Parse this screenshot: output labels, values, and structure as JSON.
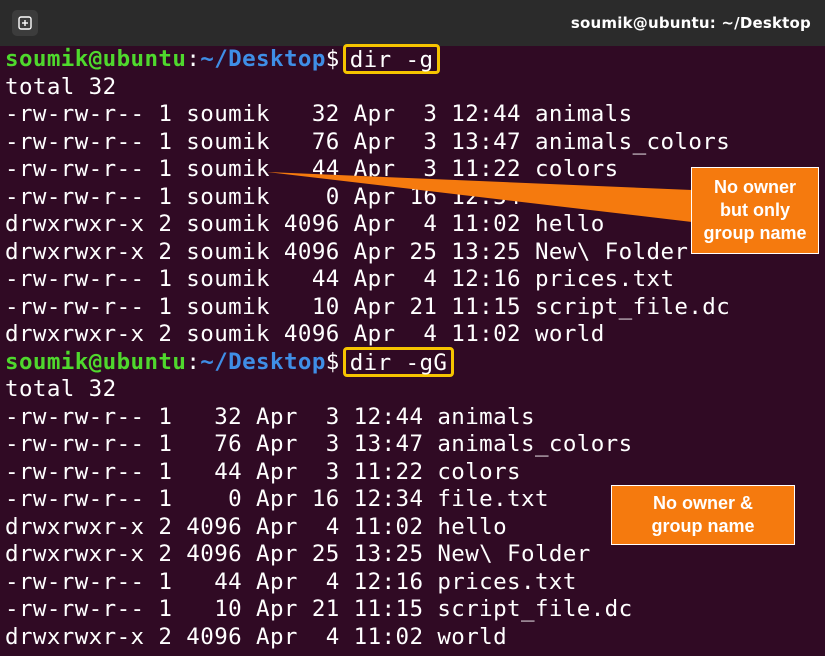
{
  "window": {
    "title": "soumik@ubuntu: ~/Desktop"
  },
  "prompt": {
    "user_host": "soumik@ubuntu",
    "colon": ":",
    "path": "~/Desktop",
    "dollar": "$"
  },
  "block1": {
    "command": "dir -g",
    "total": "total 32",
    "rows": [
      "-rw-rw-r-- 1 soumik   32 Apr  3 12:44 animals",
      "-rw-rw-r-- 1 soumik   76 Apr  3 13:47 animals_colors",
      "-rw-rw-r-- 1 soumik   44 Apr  3 11:22 colors",
      "-rw-rw-r-- 1 soumik    0 Apr 16 12:34 file.txt",
      "drwxrwxr-x 2 soumik 4096 Apr  4 11:02 hello",
      "drwxrwxr-x 2 soumik 4096 Apr 25 13:25 New\\ Folder",
      "-rw-rw-r-- 1 soumik   44 Apr  4 12:16 prices.txt",
      "-rw-rw-r-- 1 soumik   10 Apr 21 11:15 script_file.dc",
      "drwxrwxr-x 2 soumik 4096 Apr  4 11:02 world"
    ]
  },
  "block2": {
    "command": "dir -gG",
    "total": "total 32",
    "rows": [
      "-rw-rw-r-- 1   32 Apr  3 12:44 animals",
      "-rw-rw-r-- 1   76 Apr  3 13:47 animals_colors",
      "-rw-rw-r-- 1   44 Apr  3 11:22 colors",
      "-rw-rw-r-- 1    0 Apr 16 12:34 file.txt",
      "drwxrwxr-x 2 4096 Apr  4 11:02 hello",
      "drwxrwxr-x 2 4096 Apr 25 13:25 New\\ Folder",
      "-rw-rw-r-- 1   44 Apr  4 12:16 prices.txt",
      "-rw-rw-r-- 1   10 Apr 21 11:15 script_file.dc",
      "drwxrwxr-x 2 4096 Apr  4 11:02 world"
    ]
  },
  "annotations": {
    "callout1_lines": [
      "No owner",
      "but only",
      "group name"
    ],
    "callout2_lines": [
      "No owner &",
      "group name"
    ]
  },
  "colors": {
    "background": "#300a24",
    "titlebar": "#2b2b2b",
    "prompt_user": "#4fd82d",
    "prompt_path": "#3f8ee6",
    "command_highlight": "#f5c400",
    "callout": "#f57a0e"
  },
  "icons": {
    "new_tab": "new-tab-icon"
  }
}
